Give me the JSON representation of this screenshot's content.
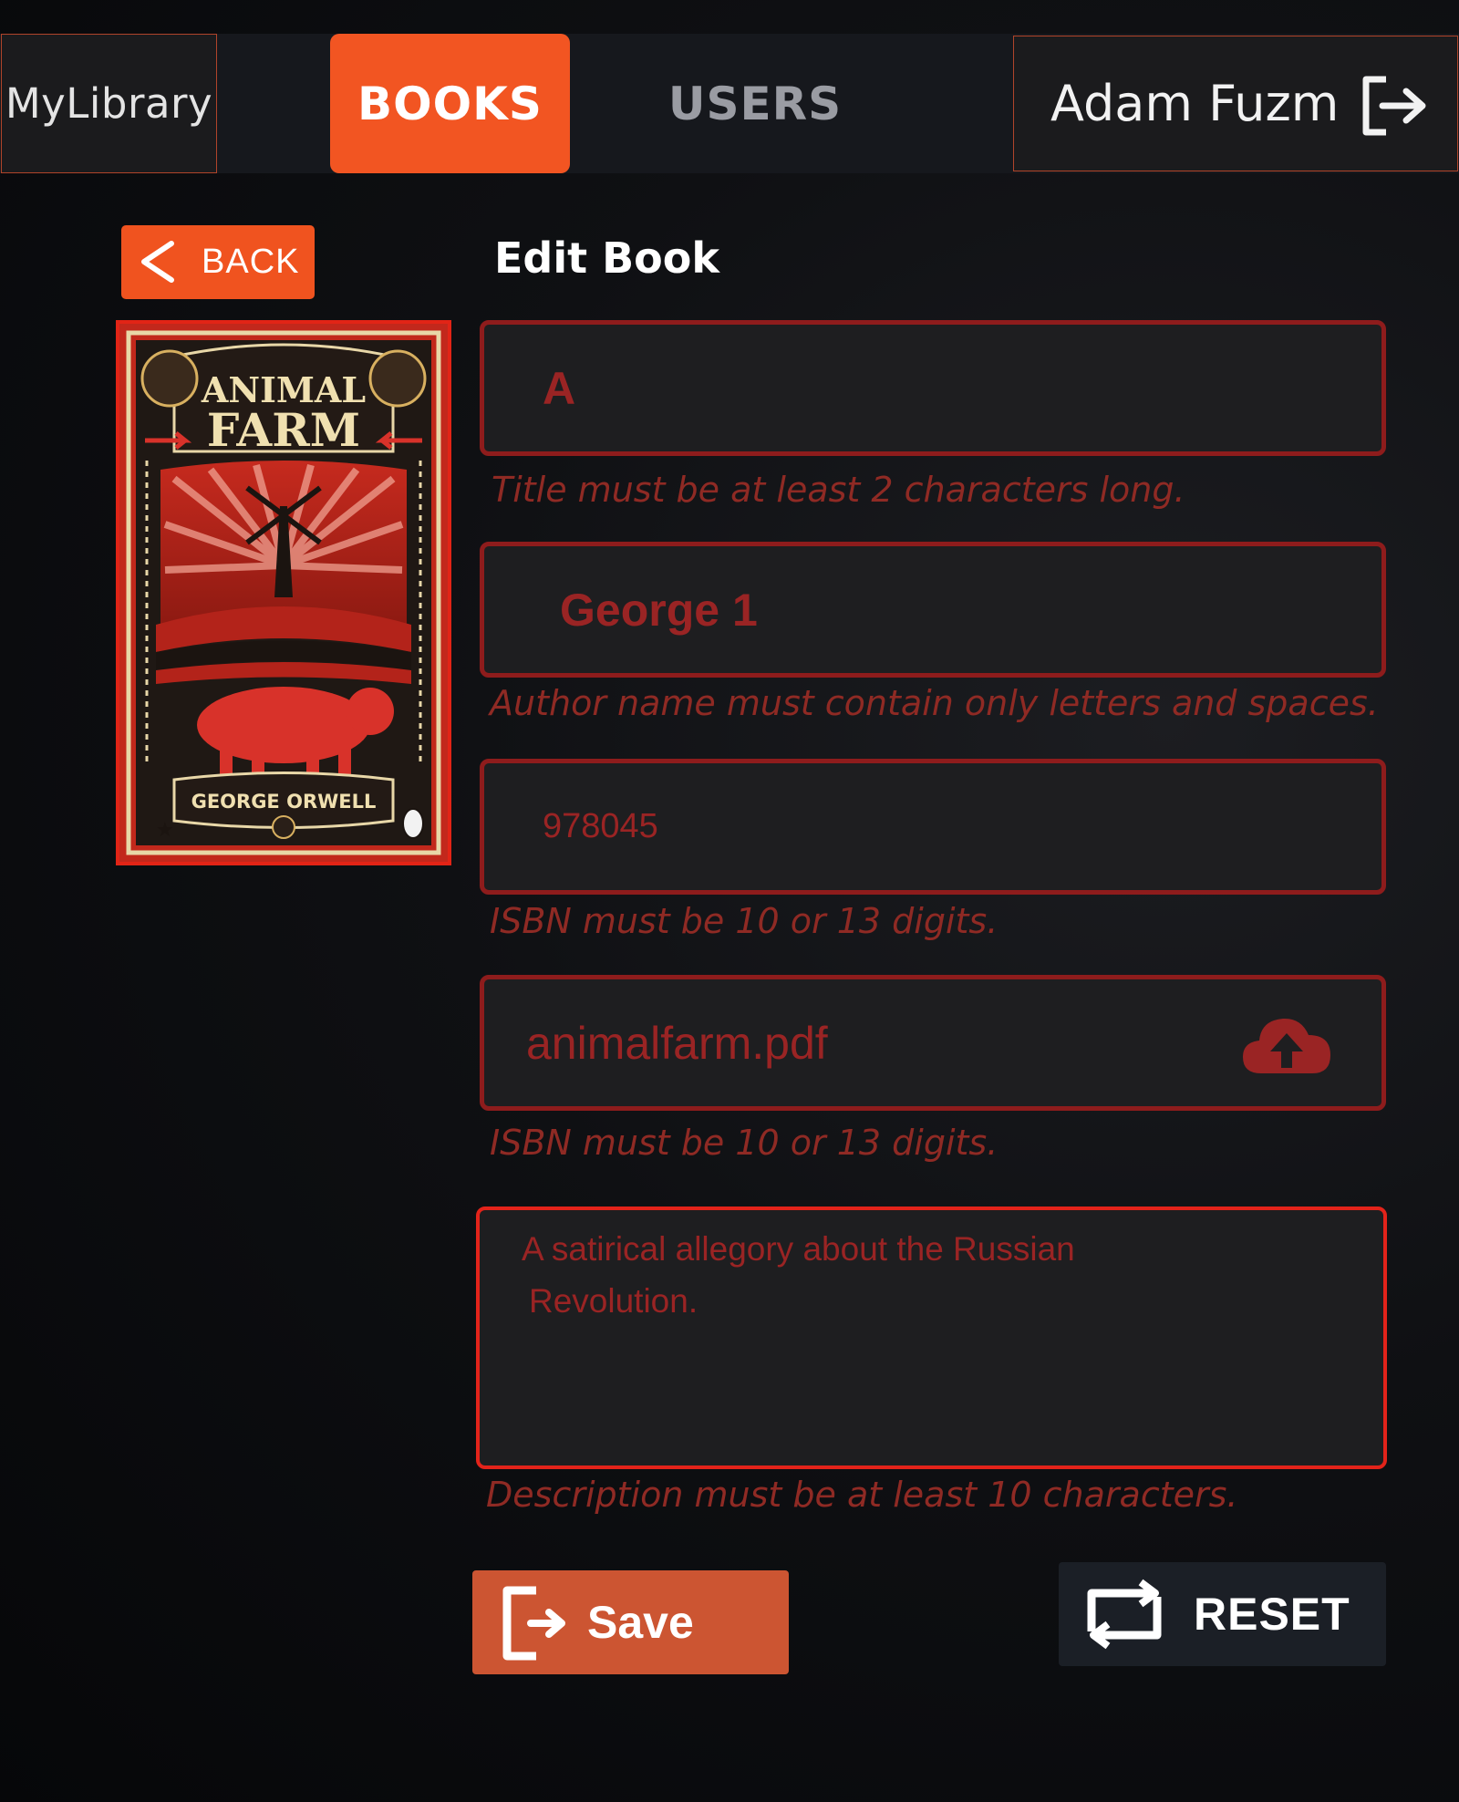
{
  "header": {
    "brand": "MyLibrary",
    "tabs": [
      {
        "label": "BOOKS",
        "active": true
      },
      {
        "label": "USERS",
        "active": false
      }
    ],
    "user_name": "Adam Fuzm",
    "logout_icon": "logout-icon"
  },
  "page": {
    "back_label": "BACK",
    "title": "Edit Book"
  },
  "cover": {
    "title_line1": "ANIMAL",
    "title_line2": "FARM",
    "author": "GEORGE ORWELL"
  },
  "form": {
    "title_value": "A",
    "title_error": "Title must be at least 2 characters long.",
    "author_value": "George 1",
    "author_error": "Author name must contain only letters and spaces.",
    "isbn_value": "978045",
    "isbn_error": "ISBN must be 10 or 13 digits.",
    "file_value": "animalfarm.pdf",
    "file_error": "ISBN must be 10 or 13 digits.",
    "description_line1": "A satirical allegory about the Russian",
    "description_line2": "Revolution.",
    "description_error": "Description must be at least 10 characters."
  },
  "actions": {
    "save_label": "Save",
    "reset_label": "RESET"
  },
  "colors": {
    "accent": "#f25522",
    "error": "#9a2424",
    "field_border": "#8e1c1c"
  }
}
